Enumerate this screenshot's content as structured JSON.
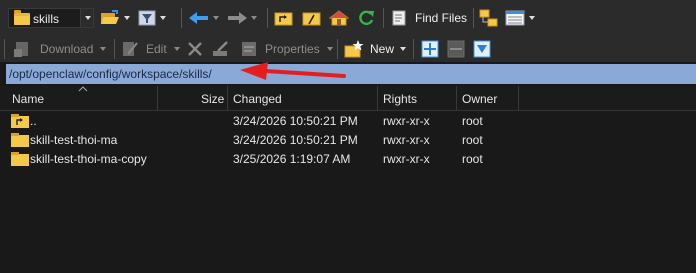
{
  "toolbar1": {
    "location_combo": {
      "value": "skills"
    },
    "find_files_label": "Find Files"
  },
  "toolbar2": {
    "download_label": "Download",
    "edit_label": "Edit",
    "properties_label": "Properties",
    "new_label": "New"
  },
  "path": "/opt/openclaw/config/workspace/skills/",
  "columns": {
    "name": "Name",
    "size": "Size",
    "changed": "Changed",
    "rights": "Rights",
    "owner": "Owner"
  },
  "files": [
    {
      "name": "..",
      "size": "",
      "changed": "3/24/2026 10:50:21 PM",
      "rights": "rwxr-xr-x",
      "owner": "root"
    },
    {
      "name": "skill-test-thoi-ma",
      "size": "",
      "changed": "3/24/2026 10:50:21 PM",
      "rights": "rwxr-xr-x",
      "owner": "root"
    },
    {
      "name": "skill-test-thoi-ma-copy",
      "size": "",
      "changed": "3/25/2026 1:19:07 AM",
      "rights": "rwxr-xr-x",
      "owner": "root"
    }
  ],
  "colors": {
    "path_bar": "#8aa9d6",
    "annotation_arrow": "#e41e1e",
    "folder": "#f4c94a"
  }
}
